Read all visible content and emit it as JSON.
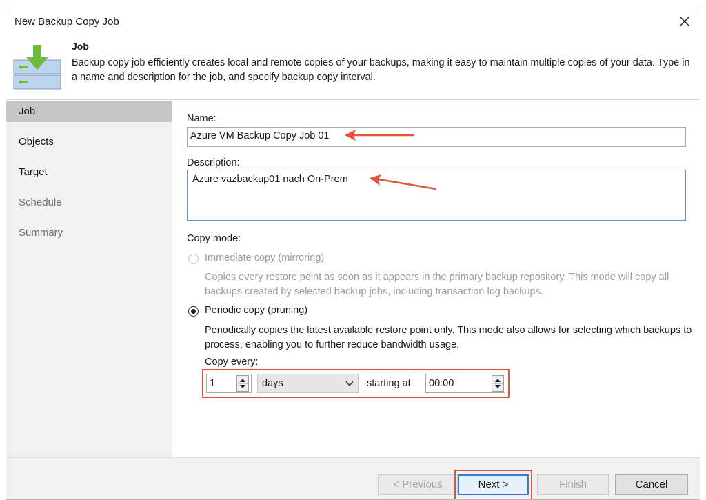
{
  "window": {
    "title": "New Backup Copy Job"
  },
  "header": {
    "title": "Job",
    "description": "Backup copy job efficiently creates local and remote copies of your backups, making it easy to maintain multiple copies of your data. Type in a name and description for the job, and specify backup copy interval.",
    "icon": "backup-copy-icon"
  },
  "sidebar": {
    "items": [
      {
        "label": "Job",
        "state": "active"
      },
      {
        "label": "Objects",
        "state": "enabled"
      },
      {
        "label": "Target",
        "state": "enabled"
      },
      {
        "label": "Schedule",
        "state": "disabled"
      },
      {
        "label": "Summary",
        "state": "disabled"
      }
    ]
  },
  "form": {
    "name_label": "Name:",
    "name_value": "Azure VM Backup Copy Job 01",
    "description_label": "Description:",
    "description_value": "Azure vazbackup01 nach On-Prem",
    "copy_mode_label": "Copy mode:",
    "immediate": {
      "label": "Immediate copy (mirroring)",
      "description": "Copies every restore point as soon as it appears in the primary backup repository. This mode will copy all backups created by selected backup jobs, including transaction log backups.",
      "selected": false,
      "enabled": false
    },
    "periodic": {
      "label": "Periodic copy (pruning)",
      "description": "Periodically copies the latest available restore point only. This mode also allows for selecting which backups to process, enabling you to further reduce bandwidth usage.",
      "selected": true,
      "enabled": true
    },
    "copy_every_label": "Copy every:",
    "interval_value": "1",
    "interval_unit": "days",
    "starting_at_label": "starting at",
    "starting_time": "00:00"
  },
  "footer": {
    "previous_label": "< Previous",
    "next_label": "Next >",
    "finish_label": "Finish",
    "cancel_label": "Cancel"
  },
  "colors": {
    "annotation": "#e2533a",
    "active_nav": "#c6c6c6",
    "focus_border": "#5b9bd5",
    "icon_green": "#6dbb3c",
    "icon_blue": "#bcd4ec"
  }
}
